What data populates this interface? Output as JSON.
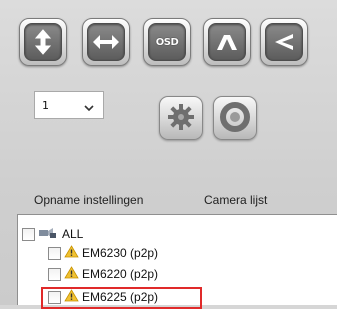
{
  "controls": {
    "buttons": [
      {
        "name": "vertical-flip-button",
        "icon": "vertical-arrows-icon"
      },
      {
        "name": "horizontal-flip-button",
        "icon": "horizontal-arrows-icon"
      },
      {
        "name": "osd-button",
        "icon": "osd-icon",
        "label": "OSD"
      },
      {
        "name": "mountain-pattern-button",
        "icon": "caret-up-icon"
      },
      {
        "name": "back-arrow-button",
        "icon": "angle-left-icon"
      }
    ]
  },
  "selector": {
    "value": "1"
  },
  "camera_buttons": [
    {
      "name": "gear-button",
      "icon": "gear-icon"
    },
    {
      "name": "record-button",
      "icon": "ring-icon"
    }
  ],
  "labels": {
    "opname": "Opname instellingen",
    "camera_list": "Camera lijst"
  },
  "tree": {
    "root": "ALL",
    "items": [
      {
        "label": "EM6230 (p2p)"
      },
      {
        "label": "EM6220 (p2p)"
      },
      {
        "label": "EM6225 (p2p)"
      }
    ]
  },
  "colors": {
    "highlight": "#e02a2a",
    "warning": "#f1c232"
  }
}
